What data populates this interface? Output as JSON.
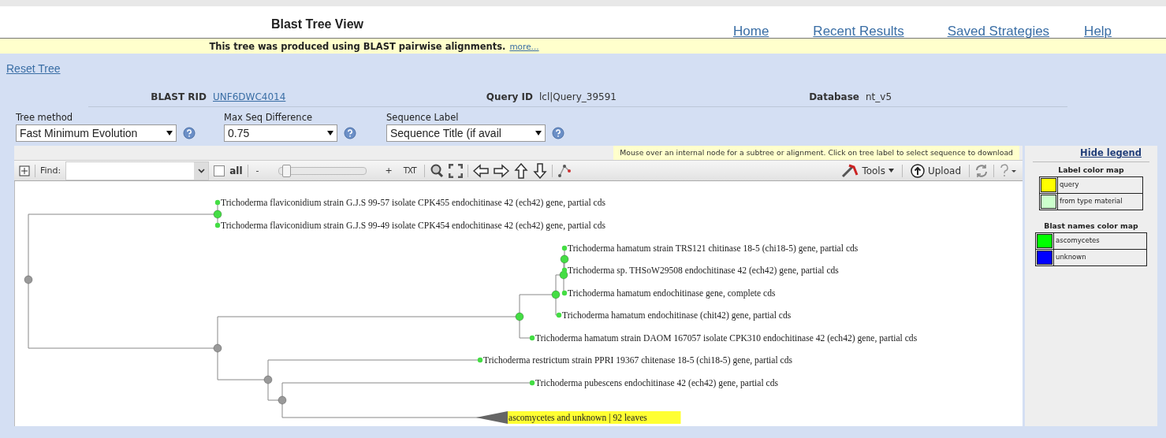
{
  "header": {
    "title": "Blast Tree View",
    "nav": [
      {
        "label": "Home"
      },
      {
        "label": "Recent Results"
      },
      {
        "label": "Saved Strategies"
      },
      {
        "label": "Help"
      }
    ]
  },
  "banner": {
    "text": "This tree was produced using BLAST pairwise alignments.",
    "link": "more..."
  },
  "reset_link": "Reset Tree",
  "info": [
    {
      "label": "BLAST RID",
      "value": "UNF6DWC4014",
      "kind": "link"
    },
    {
      "label": "Query ID",
      "value": "lcl|Query_39591",
      "kind": "text"
    },
    {
      "label": "Database",
      "value": "nt_v5",
      "kind": "text"
    }
  ],
  "options": [
    {
      "label": "Tree method",
      "value": "Fast Minimum Evolution"
    },
    {
      "label": "Max Seq Difference",
      "value": "0.75"
    },
    {
      "label": "Sequence Label",
      "value": "Sequence Title (if avail"
    }
  ],
  "hint": "Mouse over an internal node for a subtree or alignment. Click on tree label to select sequence to download",
  "toolbar": {
    "find_label": "Find:",
    "all_label": "all",
    "all_checked": false,
    "minus": "-",
    "plus": "+",
    "slider": {
      "level": 0.04
    },
    "txt": "TXT",
    "tools": "Tools",
    "upload": "Upload"
  },
  "tree": {
    "kind": "node",
    "color": "#999999",
    "children": [
      {
        "kind": "node",
        "color": "#44dd44",
        "children": [
          {
            "kind": "leaf",
            "color": "#44dd44",
            "label": "Trichoderma flaviconidium strain G.J.S 99-57 isolate CPK455 endochitinase 42 (ech42) gene, partial cds"
          },
          {
            "kind": "leaf",
            "color": "#44dd44",
            "label": "Trichoderma flaviconidium strain G.J.S 99-49 isolate CPK454 endochitinase 42 (ech42) gene, partial cds"
          }
        ]
      },
      {
        "kind": "node",
        "color": "#999999",
        "children": [
          {
            "kind": "node",
            "color": "#44dd44",
            "children": [
              {
                "kind": "node",
                "color": "#44dd44",
                "children": [
                  {
                    "kind": "node",
                    "color": "#44dd44",
                    "children": [
                      {
                        "kind": "node",
                        "color": "#44dd44",
                        "children": [
                          {
                            "kind": "leaf",
                            "color": "#44dd44",
                            "label": "Trichoderma hamatum strain TRS121 chitinase 18-5 (chi18-5) gene, partial cds"
                          },
                          {
                            "kind": "leaf",
                            "color": "#44dd44",
                            "label": "Trichoderma sp. THSoW29508 endochitinase 42 (ech42) gene, partial cds"
                          }
                        ]
                      },
                      {
                        "kind": "leaf",
                        "color": "#44dd44",
                        "label": "Trichoderma hamatum endochitinase gene, complete cds"
                      }
                    ]
                  },
                  {
                    "kind": "leaf",
                    "color": "#44dd44",
                    "label": "Trichoderma hamatum endochitinase (chit42) gene, partial cds"
                  }
                ]
              },
              {
                "kind": "leaf",
                "color": "#44dd44",
                "label": "Trichoderma hamatum strain DAOM 167057 isolate CPK310 endochitinase 42 (ech42) gene, partial cds"
              }
            ]
          },
          {
            "kind": "node",
            "color": "#999999",
            "children": [
              {
                "kind": "leaf",
                "color": "#44dd44",
                "label": "Trichoderma restrictum strain PPRI 19367 chitenase 18-5 (chi18-5) gene, partial cds"
              },
              {
                "kind": "node",
                "color": "#999999",
                "children": [
                  {
                    "kind": "leaf",
                    "color": "#44dd44",
                    "label": "Trichoderma pubescens endochitinase 42 (ech42) gene, partial cds"
                  },
                  {
                    "kind": "collapsed",
                    "color": "#666666",
                    "label": "ascomycetes and unknown | 92 leaves",
                    "highlighted": true
                  }
                ]
              }
            ]
          }
        ]
      }
    ]
  },
  "legend": {
    "hide_link": "Hide legend",
    "label_map_title": "Label color map",
    "label_map": [
      {
        "name": "query",
        "color": "#ffff00"
      },
      {
        "name": "from type material",
        "color": "#ccffcc"
      }
    ],
    "blast_map_title": "Blast names color map",
    "blast_map": [
      {
        "name": "ascomycetes",
        "color": "#00ff00"
      },
      {
        "name": "unknown",
        "color": "#0000ff"
      }
    ]
  }
}
